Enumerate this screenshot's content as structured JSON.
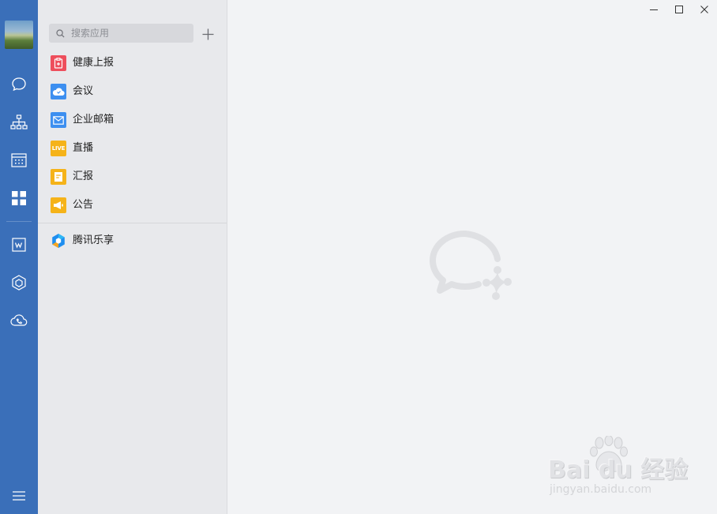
{
  "rail": {
    "nav_icons": [
      "chat-icon",
      "org-chart-icon",
      "calendar-icon",
      "workbench-icon",
      "docs-icon",
      "hexagon-app-icon",
      "cloud-phone-icon",
      "menu-icon"
    ]
  },
  "apps_panel": {
    "search_placeholder": "搜索应用",
    "add_label": "+",
    "items": [
      {
        "label": "健康上报",
        "icon": "health-report-icon",
        "color": "#ee4e5c"
      },
      {
        "label": "会议",
        "icon": "meeting-cloud-icon",
        "color": "#3d8ff0"
      },
      {
        "label": "企业邮箱",
        "icon": "mail-icon",
        "color": "#3d8ff0"
      },
      {
        "label": "直播",
        "icon": "live-icon",
        "icon_text": "LIVE",
        "color": "#f5b319"
      },
      {
        "label": "汇报",
        "icon": "report-doc-icon",
        "color": "#f5b319"
      },
      {
        "label": "公告",
        "icon": "announcement-icon",
        "color": "#f5b319"
      },
      {
        "label": "腾讯乐享",
        "icon": "tencent-lexiang-icon",
        "color": "#1e8ef0"
      }
    ]
  },
  "window_controls": [
    "minimize",
    "maximize",
    "close"
  ],
  "watermark": {
    "top": "Bai  du 经验",
    "bottom": "jingyan.baidu.com"
  },
  "colors": {
    "rail_bg": "#3a6fb9",
    "panel_bg": "#e8e9ec",
    "main_bg": "#f2f3f5"
  }
}
